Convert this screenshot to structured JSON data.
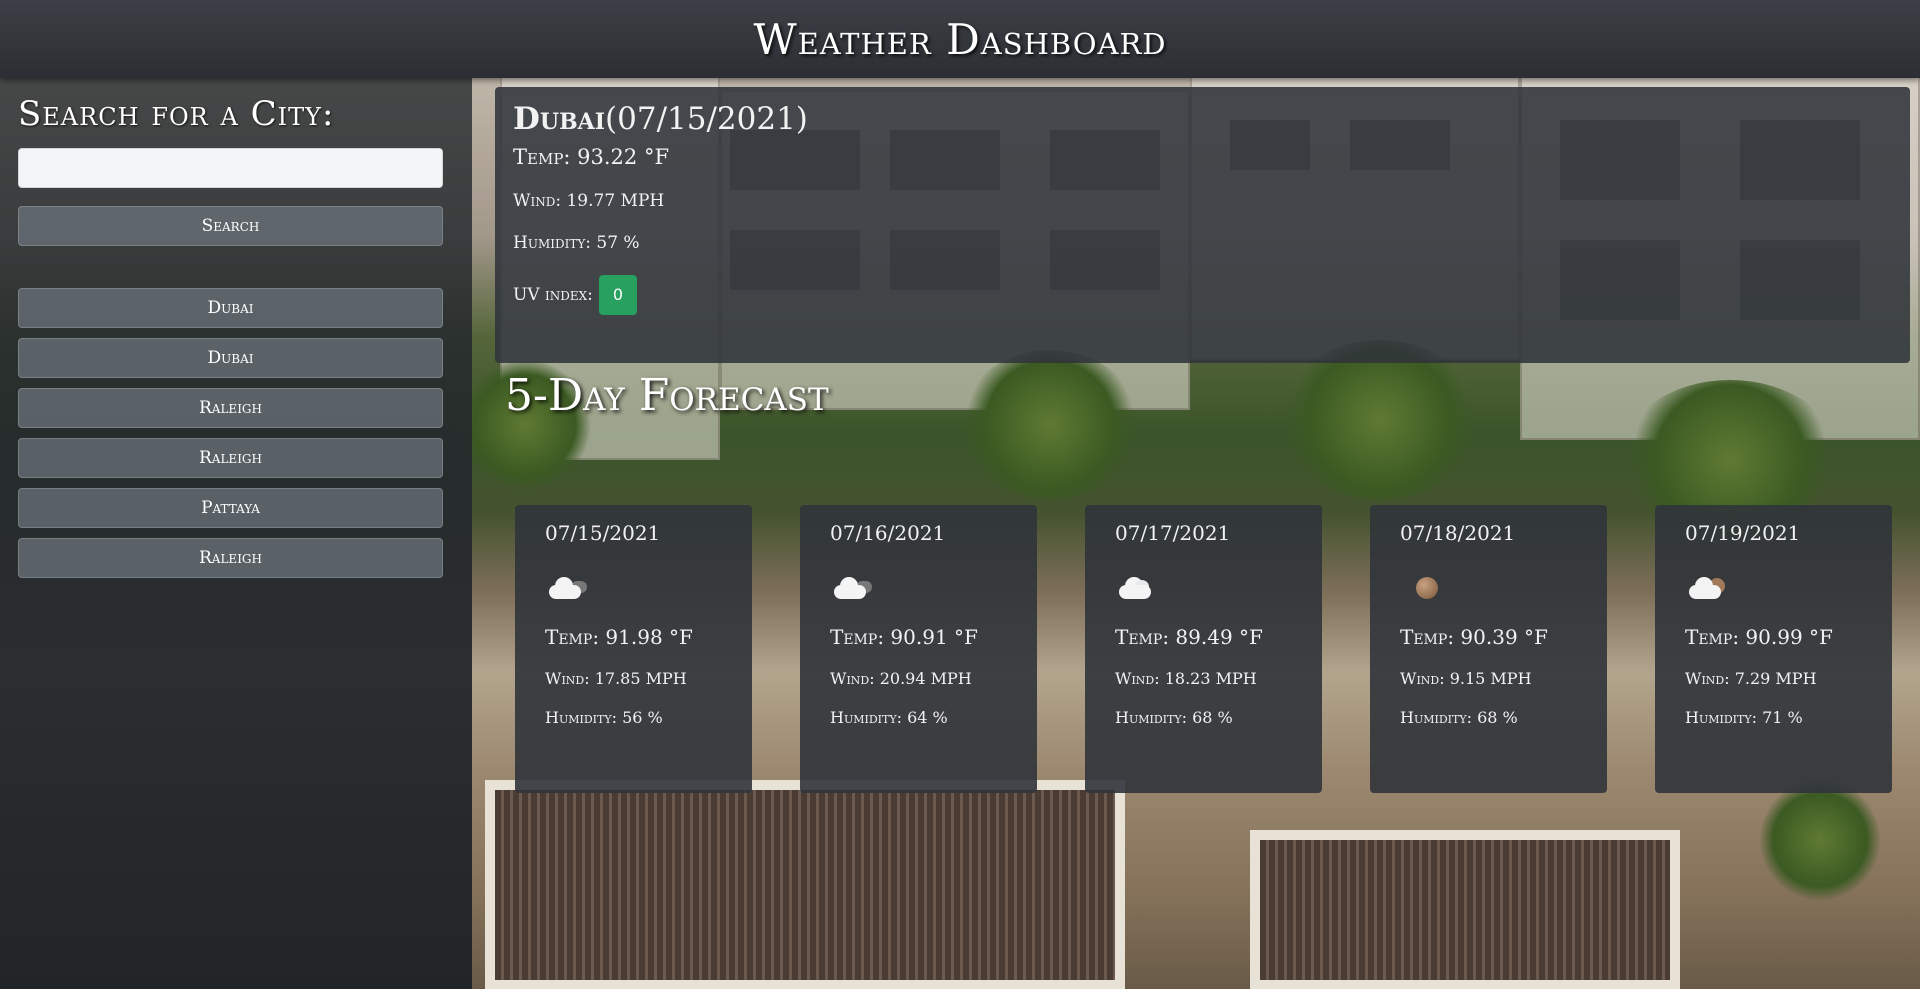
{
  "header": {
    "title": "Weather Dashboard"
  },
  "sidebar": {
    "heading": "Search for a City:",
    "search_input": {
      "value": "",
      "placeholder": ""
    },
    "search_button": "Search",
    "history": [
      "Dubai",
      "Dubai",
      "Raleigh",
      "Raleigh",
      "Pattaya",
      "Raleigh"
    ]
  },
  "current": {
    "city": "Dubai",
    "date": "(07/15/2021)",
    "temp": "Temp: 93.22 °F",
    "wind": "Wind: 19.77 MPH",
    "humidity": "Humidity: 57 %",
    "uv_label": "UV index:",
    "uv_value": "0",
    "uv_color": "#28a060"
  },
  "forecast": {
    "title": "5-Day Forecast",
    "days": [
      {
        "date": "07/15/2021",
        "icon": "partly-cloudy-icon",
        "temp": "Temp: 91.98 °F",
        "wind": "Wind: 17.85 MPH",
        "humidity": "Humidity: 56 %"
      },
      {
        "date": "07/16/2021",
        "icon": "partly-cloudy-icon",
        "temp": "Temp: 90.91 °F",
        "wind": "Wind: 20.94 MPH",
        "humidity": "Humidity: 64 %"
      },
      {
        "date": "07/17/2021",
        "icon": "cloud-icon",
        "temp": "Temp: 89.49 °F",
        "wind": "Wind: 18.23 MPH",
        "humidity": "Humidity: 68 %"
      },
      {
        "date": "07/18/2021",
        "icon": "haze-icon",
        "temp": "Temp: 90.39 °F",
        "wind": "Wind: 9.15 MPH",
        "humidity": "Humidity: 68 %"
      },
      {
        "date": "07/19/2021",
        "icon": "cloud-haze-icon",
        "temp": "Temp: 90.99 °F",
        "wind": "Wind: 7.29 MPH",
        "humidity": "Humidity: 71 %"
      }
    ]
  }
}
